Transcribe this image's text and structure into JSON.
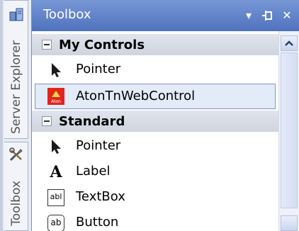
{
  "side_tabs": {
    "server_explorer": "Server Explorer",
    "toolbox": "Toolbox"
  },
  "panel": {
    "title": "Toolbox",
    "buttons": {
      "dropdown": "▾",
      "pin": "⊣",
      "close": "✕"
    }
  },
  "groups": [
    {
      "title": "My Controls",
      "items": [
        {
          "label": "Pointer",
          "icon": "pointer-icon"
        },
        {
          "label": "AtonTnWebControl",
          "icon": "aton-control-icon",
          "icon_text": "Aton",
          "selected": true
        }
      ]
    },
    {
      "title": "Standard",
      "items": [
        {
          "label": "Pointer",
          "icon": "pointer-icon"
        },
        {
          "label": "Label",
          "icon": "label-icon",
          "icon_text": "A"
        },
        {
          "label": "TextBox",
          "icon": "textbox-icon",
          "icon_text": "abl"
        },
        {
          "label": "Button",
          "icon": "button-icon",
          "icon_text": "ab"
        }
      ]
    }
  ],
  "colors": {
    "titlebar": "#4f72bd",
    "selection_border": "#7d93c8",
    "group_header": "#d6dae4"
  }
}
